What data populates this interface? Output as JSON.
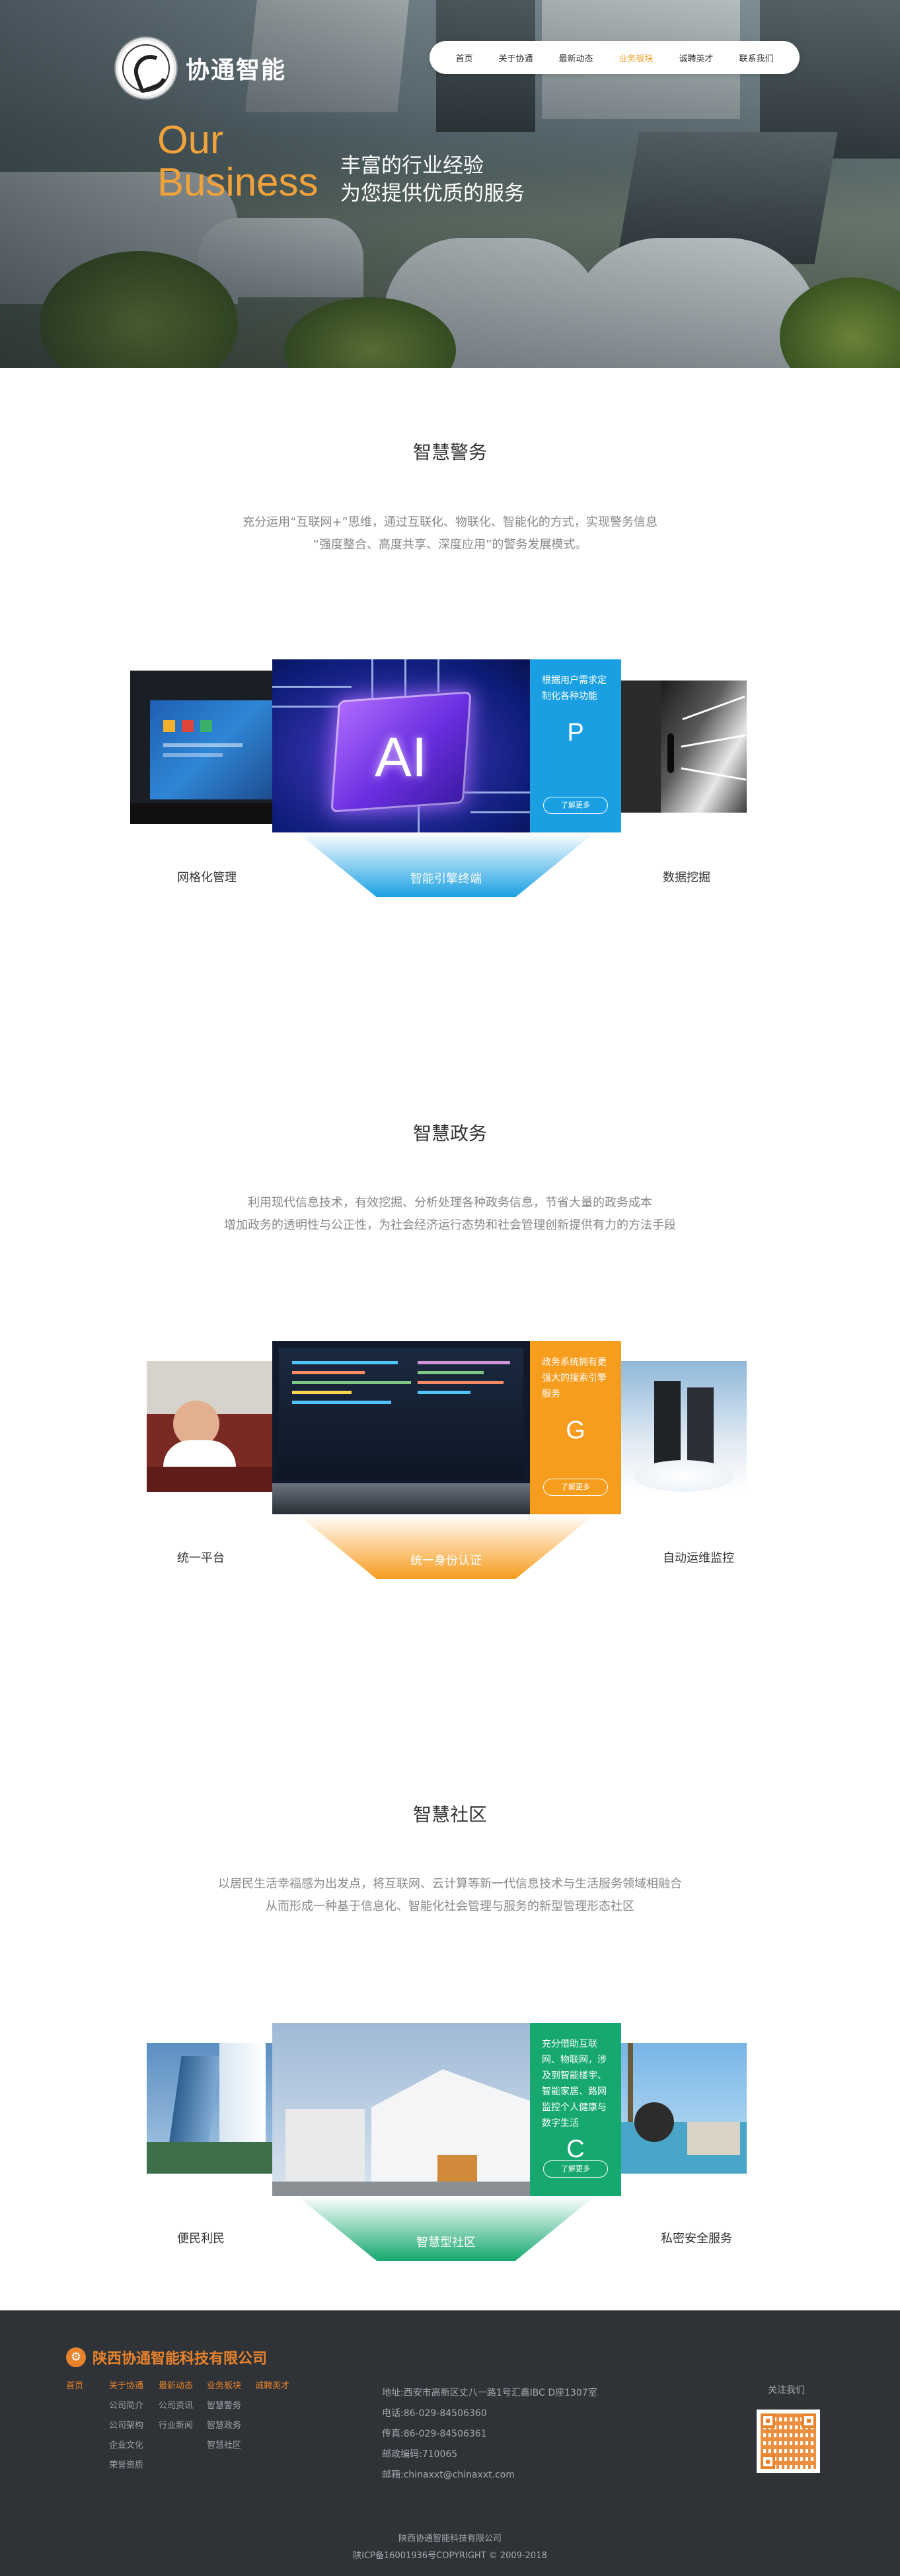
{
  "brand": {
    "name": "协通智能"
  },
  "nav": {
    "items": [
      {
        "label": "首页"
      },
      {
        "label": "关于协通"
      },
      {
        "label": "最新动态"
      },
      {
        "label": "业务板块"
      },
      {
        "label": "诚聘英才"
      },
      {
        "label": "联系我们"
      }
    ],
    "active_index": 3,
    "active_color": "#f49c1a"
  },
  "hero": {
    "en_line1": "Our",
    "en_line2": "Business",
    "cn_line1": "丰富的行业经验",
    "cn_line2": "为您提供优质的服务"
  },
  "sections": [
    {
      "title": "智慧警务",
      "desc_line1": "充分运用“互联网+”思维，通过互联化、物联化、智能化的方式，实现警务信息",
      "desc_line2": "“强度整合、高度共享、深度应用”的警务发展模式。",
      "left_label": "网格化管理",
      "right_label": "数据挖掘",
      "center_caption": "智能引擎终端",
      "panel_text": "根据用户需求定制化各种功能",
      "panel_letter": "P",
      "panel_button": "了解更多",
      "accent": "#1aa0e2"
    },
    {
      "title": "智慧政务",
      "desc_line1": "利用现代信息技术，有效挖掘、分析处理各种政务信息，节省大量的政务成本",
      "desc_line2": "增加政务的透明性与公正性，为社会经济运行态势和社会管理创新提供有力的方法手段",
      "left_label": "统一平台",
      "right_label": "自动运维监控",
      "center_caption": "统一身份认证",
      "panel_text": "政务系统拥有更强大的搜索引擎服务",
      "panel_letter": "G",
      "panel_button": "了解更多",
      "accent": "#f79d1e"
    },
    {
      "title": "智慧社区",
      "desc_line1": "以居民生活幸福感为出发点，将互联网、云计算等新一代信息技术与生活服务领域相融合",
      "desc_line2": "从而形成一种基于信息化、智能化社会管理与服务的新型管理形态社区",
      "left_label": "便民利民",
      "right_label": "私密安全服务",
      "center_caption": "智慧型社区",
      "panel_text": "充分借助互联网、物联网，涉及到智能楼宇、智能家居、路网监控个人健康与数字生活",
      "panel_letter": "C",
      "panel_button": "了解更多",
      "accent": "#16a86f"
    }
  ],
  "footer": {
    "company": "陕西协通智能科技有限公司",
    "columns": [
      {
        "head": "首页",
        "items": []
      },
      {
        "head": "关于协通",
        "items": [
          "公司简介",
          "公司架构",
          "企业文化",
          "荣誉资质"
        ]
      },
      {
        "head": "最新动态",
        "items": [
          "公司资讯",
          "行业新闻"
        ]
      },
      {
        "head": "业务板块",
        "items": [
          "智慧警务",
          "智慧政务",
          "智慧社区"
        ]
      },
      {
        "head": "诚聘英才",
        "items": []
      }
    ],
    "address": "地址:西安市高新区丈八一路1号汇鑫IBC D座1307室",
    "phone": "电话:86-029-84506360",
    "fax": "传真:86-029-84506361",
    "postcode": "邮政编码:710065",
    "email": "邮箱:chinaxxt@chinaxxt.com",
    "follow": "关注我们",
    "copy_line1": "陕西协通智能科技有限公司",
    "copy_line2": "陕ICP备16001936号COPYRIGHT © 2009-2018",
    "accent": "#e9832b"
  }
}
